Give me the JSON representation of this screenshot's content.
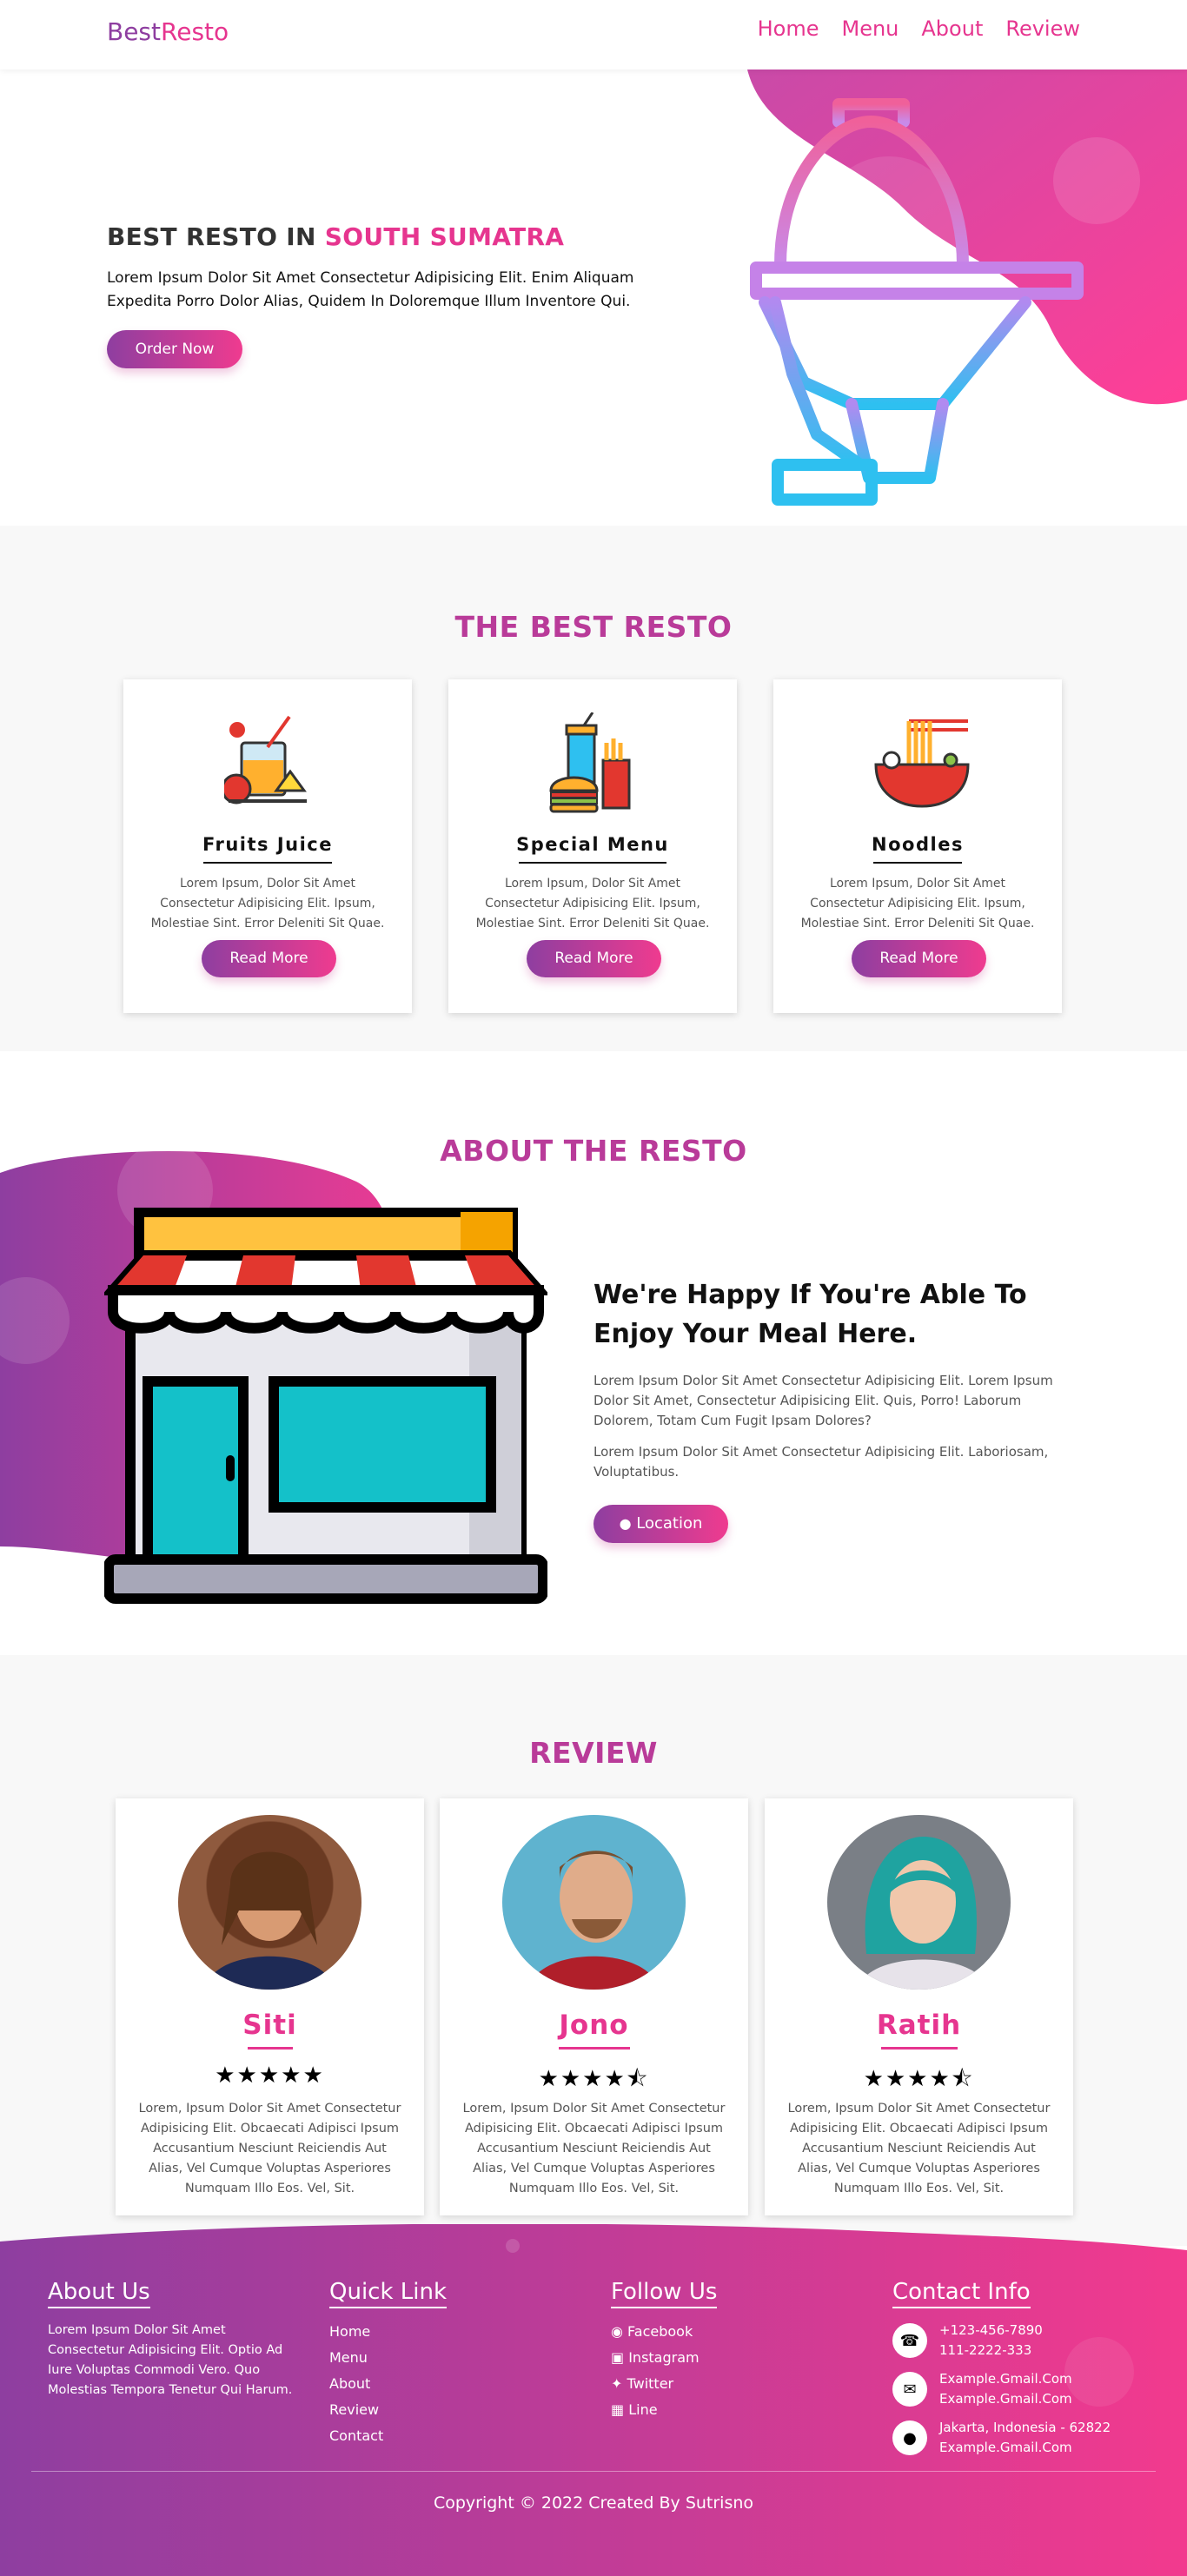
{
  "nav": {
    "brand_part1": "Best",
    "brand_part2": "Resto",
    "links": [
      "Home",
      "Menu",
      "About",
      "Review"
    ]
  },
  "hero": {
    "title_part1": "BEST RESTO IN ",
    "title_highlight": "SOUTH SUMATRA",
    "description": "Lorem Ipsum Dolor Sit Amet Consectetur Adipisicing Elit. Enim Aliquam Expedita Porro Dolor Alias, Quidem In Doloremque Illum Inventore Qui.",
    "button": "Order Now"
  },
  "best": {
    "title": "THE BEST RESTO",
    "cards": [
      {
        "title": "Fruits Juice",
        "icon": "juice-icon",
        "description": "Lorem Ipsum, Dolor Sit Amet Consectetur Adipisicing Elit. Ipsum, Molestiae Sint. Error Deleniti Sit Quae.",
        "button": "Read More"
      },
      {
        "title": "Special Menu",
        "icon": "fastfood-icon",
        "description": "Lorem Ipsum, Dolor Sit Amet Consectetur Adipisicing Elit. Ipsum, Molestiae Sint. Error Deleniti Sit Quae.",
        "button": "Read More"
      },
      {
        "title": "Noodles",
        "icon": "noodles-icon",
        "description": "Lorem Ipsum, Dolor Sit Amet Consectetur Adipisicing Elit. Ipsum, Molestiae Sint. Error Deleniti Sit Quae.",
        "button": "Read More"
      }
    ]
  },
  "about": {
    "title": "ABOUT THE RESTO",
    "heading": "We're Happy If You're Able To Enjoy Your Meal Here.",
    "p1": "Lorem Ipsum Dolor Sit Amet Consectetur Adipisicing Elit. Lorem Ipsum Dolor Sit Amet, Consectetur Adipisicing Elit. Quis, Porro! Laborum Dolorem, Totam Cum Fugit Ipsam Dolores?",
    "p2": "Lorem Ipsum Dolor Sit Amet Consectetur Adipisicing Elit. Laboriosam, Voluptatibus.",
    "button": "Location"
  },
  "review": {
    "title": "REVIEW",
    "cards": [
      {
        "name": "Siti",
        "rating": 5,
        "stars": "★★★★★",
        "text": "Lorem, Ipsum Dolor Sit Amet Consectetur Adipisicing Elit. Obcaecati Adipisci Ipsum Accusantium Nesciunt Reiciendis Aut Alias, Vel Cumque Voluptas Asperiores Numquam Illo Eos. Vel, Sit."
      },
      {
        "name": "Jono",
        "rating": 4.5,
        "stars": "★★★★",
        "text": "Lorem, Ipsum Dolor Sit Amet Consectetur Adipisicing Elit. Obcaecati Adipisci Ipsum Accusantium Nesciunt Reiciendis Aut Alias, Vel Cumque Voluptas Asperiores Numquam Illo Eos. Vel, Sit."
      },
      {
        "name": "Ratih",
        "rating": 4.5,
        "stars": "★★★★",
        "text": "Lorem, Ipsum Dolor Sit Amet Consectetur Adipisicing Elit. Obcaecati Adipisci Ipsum Accusantium Nesciunt Reiciendis Aut Alias, Vel Cumque Voluptas Asperiores Numquam Illo Eos. Vel, Sit."
      }
    ]
  },
  "footer": {
    "about_title": "About Us",
    "about_text": "Lorem Ipsum Dolor Sit Amet Consectetur Adipisicing Elit. Optio Ad Iure Voluptas Commodi Vero. Quo Molestias Tempora Tenetur Qui Harum.",
    "quick_title": "Quick Link",
    "quick_links": [
      "Home",
      "Menu",
      "About",
      "Review",
      "Contact"
    ],
    "follow_title": "Follow Us",
    "follow_links": [
      "Facebook",
      "Instagram",
      "Twitter",
      "Line"
    ],
    "contact_title": "Contact Info",
    "contact_phone": [
      "+123-456-7890",
      "111-2222-333"
    ],
    "contact_email": [
      "Example.Gmail.Com",
      "Example.Gmail.Com"
    ],
    "contact_address": [
      "Jakarta, Indonesia - 62822",
      "Example.Gmail.Com"
    ],
    "copyright": "Copyright © 2022 Created By Sutrisno"
  },
  "colors": {
    "purple": "#8e3ea0",
    "pink": "#ef3b8f",
    "title": "#b93b99"
  }
}
